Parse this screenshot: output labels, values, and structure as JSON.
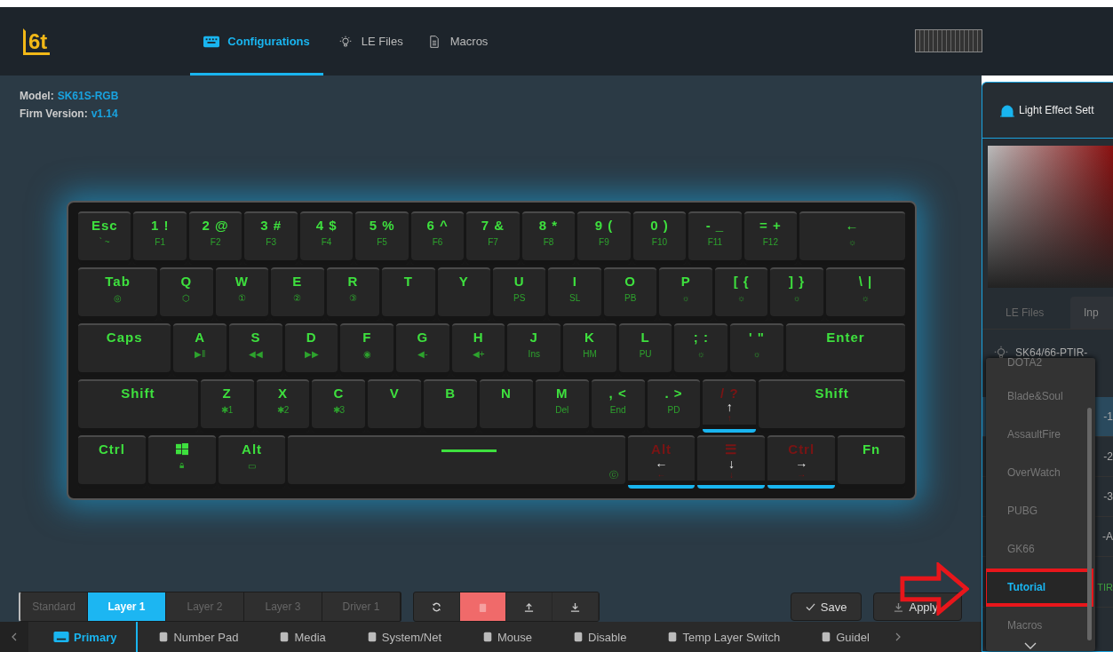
{
  "app": {
    "logo": "6t"
  },
  "nav_tabs": [
    {
      "label": "Configurations",
      "selected": true
    },
    {
      "label": "LE Files",
      "selected": false
    },
    {
      "label": "Macros",
      "selected": false
    }
  ],
  "device_info": [
    {
      "label": "Model:",
      "value": "SK61S-RGB"
    },
    {
      "label": "Firm Version:",
      "value": "v1.14"
    }
  ],
  "keyboard": {
    "rows": [
      {
        "keys": [
          {
            "main": "Esc",
            "sub": "` ~"
          },
          {
            "main": "1 !",
            "sub": "F1"
          },
          {
            "main": "2 @",
            "sub": "F2"
          },
          {
            "main": "3 #",
            "sub": "F3"
          },
          {
            "main": "4 $",
            "sub": "F4"
          },
          {
            "main": "5 %",
            "sub": "F5"
          },
          {
            "main": "6 ^",
            "sub": "F6"
          },
          {
            "main": "7 &",
            "sub": "F7"
          },
          {
            "main": "8 *",
            "sub": "F8"
          },
          {
            "main": "9 (",
            "sub": "F9"
          },
          {
            "main": "0 )",
            "sub": "F10"
          },
          {
            "main": "- _",
            "sub": "F11"
          },
          {
            "main": "= +",
            "sub": "F12"
          },
          {
            "main": "←",
            "sub": "☼"
          }
        ]
      },
      {
        "keys": [
          {
            "main": "Tab",
            "sub": "◎"
          },
          {
            "main": "Q",
            "sub": "⬡"
          },
          {
            "main": "W",
            "sub": "①"
          },
          {
            "main": "E",
            "sub": "②"
          },
          {
            "main": "R",
            "sub": "③"
          },
          {
            "main": "T"
          },
          {
            "main": "Y"
          },
          {
            "main": "U",
            "sub": "PS"
          },
          {
            "main": "I",
            "sub": "SL"
          },
          {
            "main": "O",
            "sub": "PB"
          },
          {
            "main": "P",
            "sub": "☼"
          },
          {
            "main": "[ {",
            "sub": "☼"
          },
          {
            "main": "] }",
            "sub": "☼"
          },
          {
            "main": "\\ |",
            "sub": "☼"
          }
        ]
      },
      {
        "keys": [
          {
            "main": "Caps"
          },
          {
            "main": "A",
            "sub": "▶‖"
          },
          {
            "main": "S",
            "sub": "◀◀"
          },
          {
            "main": "D",
            "sub": "▶▶"
          },
          {
            "main": "F",
            "sub": "◉"
          },
          {
            "main": "G",
            "sub": "◀-"
          },
          {
            "main": "H",
            "sub": "◀+"
          },
          {
            "main": "J",
            "sub": "Ins"
          },
          {
            "main": "K",
            "sub": "HM"
          },
          {
            "main": "L",
            "sub": "PU"
          },
          {
            "main": "; :",
            "sub": "☼"
          },
          {
            "main": "' \"",
            "sub": "☼"
          },
          {
            "main": "Enter"
          }
        ]
      },
      {
        "keys": [
          {
            "main": "Shift"
          },
          {
            "main": "Z",
            "sub": "✱1"
          },
          {
            "main": "X",
            "sub": "✱2"
          },
          {
            "main": "C",
            "sub": "✱3"
          },
          {
            "main": "V"
          },
          {
            "main": "B"
          },
          {
            "main": "N"
          },
          {
            "main": "M",
            "sub": "Del"
          },
          {
            "main": ", <",
            "sub": "End"
          },
          {
            "main": ". >",
            "sub": "PD"
          },
          {
            "main": "/ ?",
            "arrow": "↑",
            "sub": "↑",
            "remapped": true
          },
          {
            "main": "Shift"
          }
        ]
      },
      {
        "keys": [
          {
            "main": "Ctrl"
          },
          {
            "kind": "windows",
            "sub": "🔒︎"
          },
          {
            "main": "Alt",
            "sub": "▭"
          },
          {
            "kind": "space",
            "sub": "ⓒ"
          },
          {
            "main": "Alt",
            "arrow": "←",
            "sub": "←",
            "remapped": true
          },
          {
            "main": "☰",
            "arrow": "↓",
            "sub": "↓",
            "remapped": true
          },
          {
            "main": "Ctrl",
            "arrow": "→",
            "sub": "→",
            "remapped": true
          },
          {
            "main": "Fn"
          }
        ]
      }
    ]
  },
  "layers": [
    {
      "label": "Standard",
      "selected": false
    },
    {
      "label": "Layer 1",
      "selected": true
    },
    {
      "label": "Layer 2",
      "selected": false
    },
    {
      "label": "Layer 3",
      "selected": false
    },
    {
      "label": "Driver 1",
      "selected": false
    }
  ],
  "actions": {
    "save": "Save",
    "apply": "Apply"
  },
  "function_tabs": [
    {
      "label": "Primary",
      "selected": true
    },
    {
      "label": "Number Pad",
      "selected": false
    },
    {
      "label": "Media",
      "selected": false
    },
    {
      "label": "System/Net",
      "selected": false
    },
    {
      "label": "Mouse",
      "selected": false
    },
    {
      "label": "Disable",
      "selected": false
    },
    {
      "label": "Temp Layer Switch",
      "selected": false
    },
    {
      "label": "Guidel",
      "selected": false
    }
  ],
  "light_panel": {
    "title": "Light Effect Sett",
    "tabs": [
      {
        "label": "LE Files",
        "selected": false
      },
      {
        "label": "Inp",
        "selected": true
      }
    ],
    "profile": "SK64/66-PTIR-",
    "rows": [
      {
        "text": "-1",
        "selected": true
      },
      {
        "text": "-2",
        "selected": false
      },
      {
        "text": "-3",
        "selected": false
      },
      {
        "text": "-A",
        "selected": false
      },
      {
        "text": "TIR",
        "selected": false
      }
    ]
  },
  "dropdown": {
    "items": [
      {
        "label": "DOTA2",
        "selected": false
      },
      {
        "label": "Blade&Soul",
        "selected": false
      },
      {
        "label": "AssaultFire",
        "selected": false
      },
      {
        "label": "OverWatch",
        "selected": false
      },
      {
        "label": "PUBG",
        "selected": false
      },
      {
        "label": "GK66",
        "selected": false
      },
      {
        "label": "Tutorial",
        "selected": true
      },
      {
        "label": "Macros",
        "selected": false
      }
    ]
  }
}
